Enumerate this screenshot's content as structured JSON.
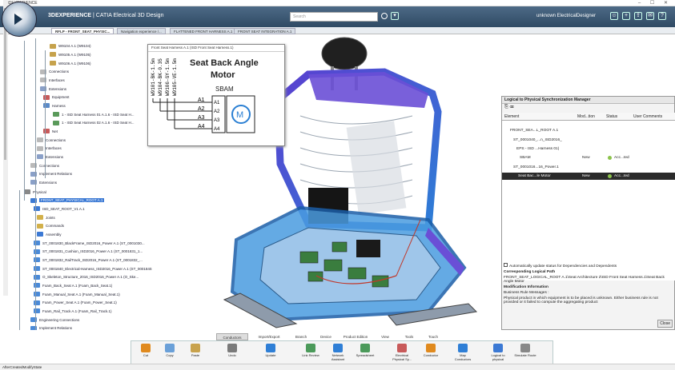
{
  "os_title": "3DEXPERIENCE",
  "window_controls": "–  ☐  ✕",
  "brand": {
    "prefix": "3DEXPERIENCE",
    "suffix": " | CATIA Electrical 3D Design"
  },
  "search_placeholder": "Search",
  "user_label": "unknown ElectricalDesigner",
  "tabs": [
    "RFLP - FRONT_SEAT_PHYSIC...",
    "Navigation experience /...",
    "FLATTENED FRONT HARNESS A.1",
    "FRONT SEAT INTEGRATION A.1"
  ],
  "tree": [
    "W9104 A.1 (W9104)",
    "W9105 A.1 (W9105)",
    "W9106 A.1 (W9106)",
    "Connections",
    "Interfaces",
    "Extensions",
    "Equipment",
    "Harness",
    "1 - ISD Seat Harness 01 A.1.6 - ISD Seat H...",
    "1 - ISD Seat Harness 02 A.1.6 - ISD Seat H...",
    "Net",
    "Connections",
    "Interfaces",
    "Extensions",
    "Connections",
    "Implement Relations",
    "Extensions",
    "Physical",
    "FRONT_SEAT_PHYSICAL_ROOT A.1",
    "ISD_SEAT_ROOT_V1 A.1",
    "Joints",
    "Commands",
    "Assembly",
    "ST_0001830_BlackFrame_ISD2016_Power A.1 (ST_0001030...",
    "ST_0001831_Cushion_ISD2016_Power A.1 (ST_0001831_1...",
    "ST_0001832_RailTrack_ISD2016_Power A.1 (ST_0001832_...",
    "ST_0001840_Electrical-Harness_ISD2016_Power A.1 (ST_0001840...",
    "O_Skeleton_Structure_2016_ISD2016_Power A.1 (O_Ske...",
    "Foam_Back_Seat A.1 (Foam_Back_Seat.1)",
    "Foam_Manual_Seat A.1 (Foam_Manual_Seat.1)",
    "Foam_Power_Seat A.1 (Foam_Power_Seat.1)",
    "Foam_Rail_Track A.1 (Foam_Rail_Track.1)",
    "Engineering Connections",
    "Implement Relations"
  ],
  "schematic": {
    "title": "Front Seat Harness A.1 (ISD Front Seat Harness.1)",
    "label": "Seat Back Angle Motor",
    "wire_labels": [
      "W9101-BK-1.5m",
      "W9104-BK-0.35",
      "W9106-GY-1.5m",
      "W9105-VE-1.5m"
    ],
    "device": "SBAM",
    "pins": [
      "A1",
      "A2",
      "A3",
      "A4"
    ],
    "motor_symbol": "M"
  },
  "sync_manager": {
    "title": "Logical to Physical Synchronization Manager",
    "columns": [
      "Element",
      "Mod...tion",
      "Status",
      "User Comments"
    ],
    "rows": [
      {
        "element": "FRONT_SEA...L_ROOT A.1",
        "mod": "",
        "status": ""
      },
      {
        "element": "ST_0001040_...n_ISD2016_",
        "mod": "",
        "status": ""
      },
      {
        "element": "EPS - ISD ...Harness 01)",
        "mod": "",
        "status": ""
      },
      {
        "element": "SBAM",
        "mod": "New",
        "status": "Acc...ted"
      },
      {
        "element": "ST_0001016...16_Power.1",
        "mod": "",
        "status": ""
      },
      {
        "element": "Seat Bac...le Motor",
        "mod": "New",
        "status": "Acc...ted"
      }
    ],
    "checkbox_label": "Automatically update status for Dependencies and Dependents",
    "logical_path_label": "Corresponding Logical Path",
    "logical_path": "FRONT_SEAT_LOGICAL_ROOT A.1\\Seat Architecture 2\\ISD Front Seat Harness.1\\Seat Back Angle Motor",
    "mod_info_label": "Modification Information",
    "business_rule_label": "Business Rule Messages :",
    "business_rule_msg": "Physical product in which equipment is to be placed is unknown. Either business rule is not provided or it failed to compute the aggregating product",
    "close_label": "Close"
  },
  "action_tabs": [
    "Conductors",
    "Import/Export",
    "Branch",
    "Device",
    "Product Edition",
    "View",
    "Tools",
    "Touch"
  ],
  "commands": [
    "Cut",
    "Copy",
    "Paste",
    "Undo",
    "Update",
    "Link Review",
    "Network Assistant",
    "Spreadsheet",
    "Electrical Physical Sy...",
    "Conductor",
    "Map Conductors",
    "Logical to physical",
    "Simulate Route"
  ],
  "status_text": "AfterCreatedModifyState",
  "colors": {
    "title_bar": "#3d5a76",
    "selection": "#3b79d4",
    "seat_blue": "#4a9ce0",
    "seat_purple": "#6a4fd6"
  }
}
